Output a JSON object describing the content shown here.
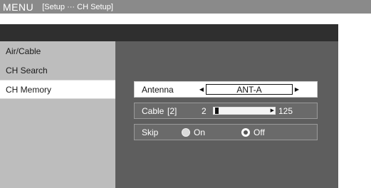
{
  "menu": {
    "title": "MENU",
    "path": "[Setup ··· CH Setup]"
  },
  "sidebar": {
    "items": [
      {
        "label": "Air/Cable"
      },
      {
        "label": "CH Search"
      },
      {
        "label": "CH Memory"
      }
    ],
    "selected_index": 2
  },
  "settings": {
    "antenna": {
      "label": "Antenna",
      "value": "ANT-A"
    },
    "cable": {
      "label": "Cable",
      "channel": "[2]",
      "value": "2",
      "max": "125",
      "level": 0.0
    },
    "skip": {
      "label": "Skip",
      "on_label": "On",
      "off_label": "Off",
      "selected": "Off"
    }
  }
}
